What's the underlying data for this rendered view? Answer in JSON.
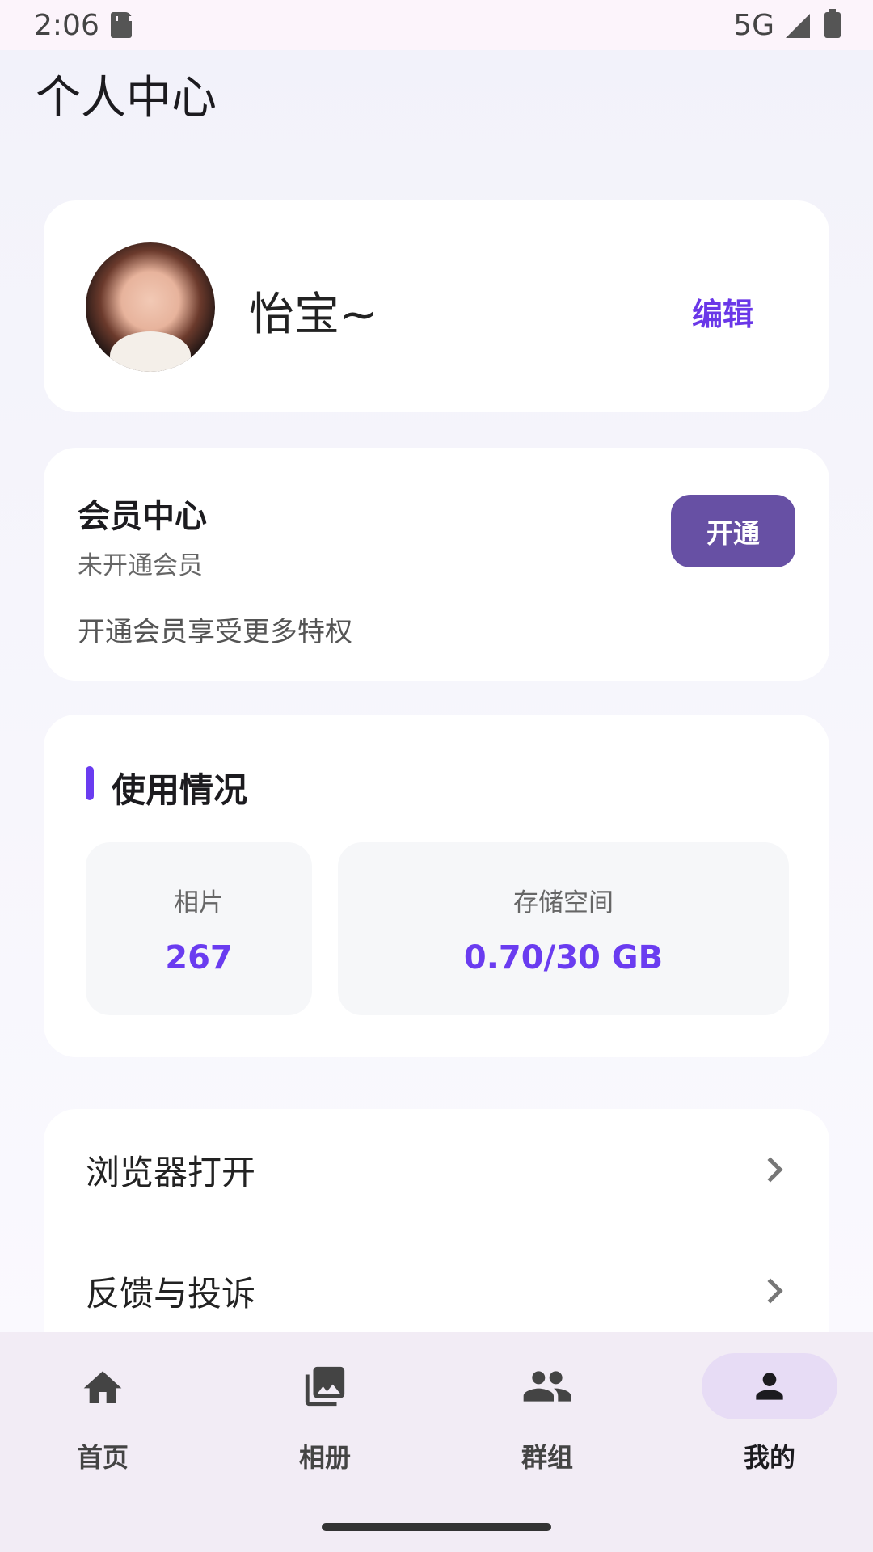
{
  "status_bar": {
    "time": "2:06",
    "network": "5G"
  },
  "header": {
    "title": "个人中心"
  },
  "profile": {
    "name": "怡宝~",
    "edit_label": "编辑"
  },
  "membership": {
    "title": "会员中心",
    "status": "未开通会员",
    "description": "开通会员享受更多特权",
    "open_label": "开通"
  },
  "usage": {
    "title": "使用情况",
    "photos_label": "相片",
    "photos_value": "267",
    "storage_label": "存储空间",
    "storage_value": "0.70/30 GB"
  },
  "menu": {
    "items": [
      {
        "label": "浏览器打开"
      },
      {
        "label": "反馈与投诉"
      }
    ]
  },
  "bottom_nav": {
    "items": [
      {
        "label": "首页",
        "icon": "home-icon"
      },
      {
        "label": "相册",
        "icon": "photo-library-icon"
      },
      {
        "label": "群组",
        "icon": "group-icon"
      },
      {
        "label": "我的",
        "icon": "person-icon",
        "active": true
      }
    ]
  },
  "colors": {
    "accent": "#6a3cf0",
    "button": "#6750a4",
    "nav_bg": "#f2ecf5"
  }
}
